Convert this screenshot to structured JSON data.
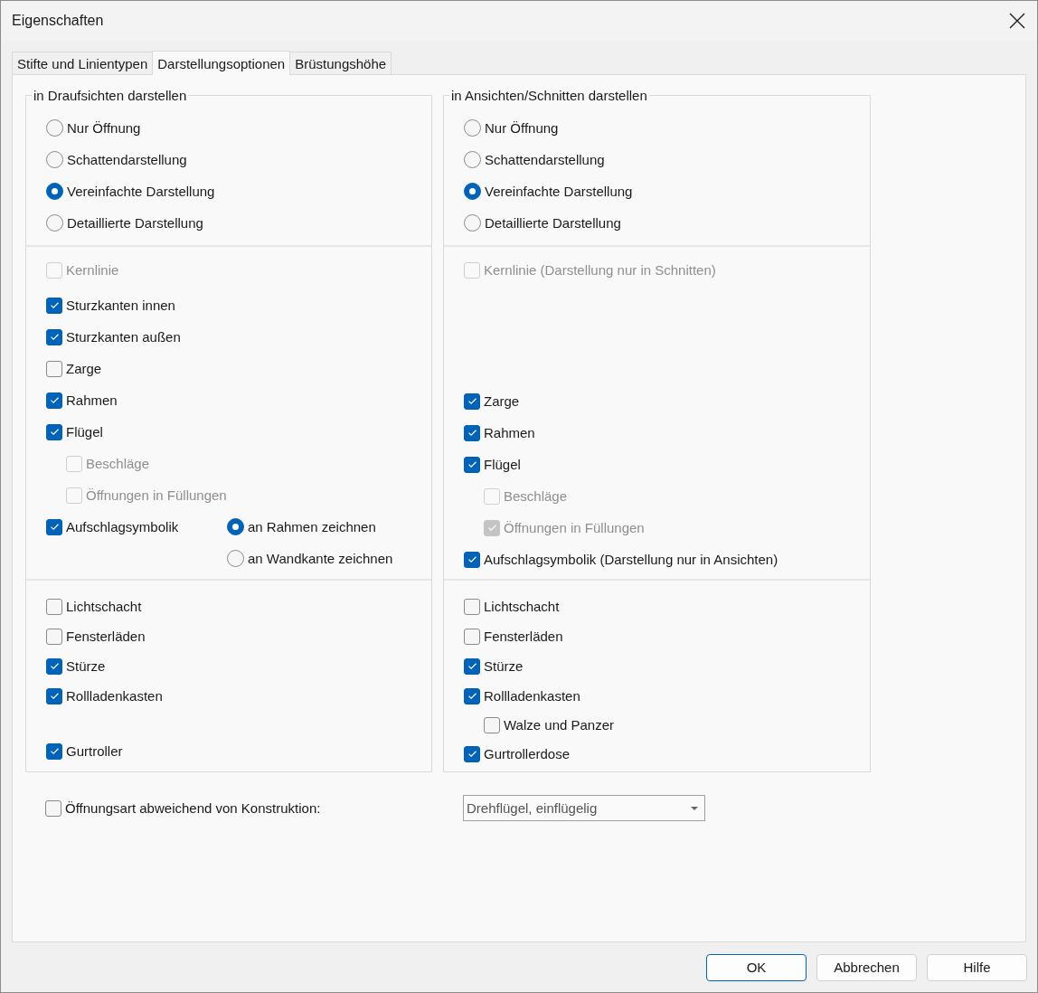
{
  "window": {
    "title": "Eigenschaften"
  },
  "tabs": [
    {
      "label": "Stifte und Linientypen",
      "selected": false
    },
    {
      "label": "Darstellungsoptionen",
      "selected": true
    },
    {
      "label": "Brüstungshöhe",
      "selected": false
    }
  ],
  "groups": [
    {
      "title": "in Draufsichten darstellen",
      "sections": [
        {
          "items": [
            {
              "kind": "radio",
              "label": "Nur Öffnung",
              "selected": false,
              "disabled": false
            },
            {
              "kind": "radio",
              "label": "Schattendarstellung",
              "selected": false,
              "disabled": false
            },
            {
              "kind": "radio",
              "label": "Vereinfachte Darstellung",
              "selected": true,
              "disabled": false
            },
            {
              "kind": "radio",
              "label": "Detaillierte Darstellung",
              "selected": false,
              "disabled": false
            }
          ]
        },
        {
          "items": [
            {
              "kind": "checkbox",
              "label": "Kernlinie",
              "checked": false,
              "disabled": true
            },
            {
              "kind": "checkbox",
              "label": "Sturzkanten innen",
              "checked": true,
              "disabled": false
            },
            {
              "kind": "checkbox",
              "label": "Sturzkanten außen",
              "checked": true,
              "disabled": false
            },
            {
              "kind": "checkbox",
              "label": "Zarge",
              "checked": false,
              "disabled": false
            },
            {
              "kind": "checkbox",
              "label": "Rahmen",
              "checked": true,
              "disabled": false
            },
            {
              "kind": "checkbox",
              "label": "Flügel",
              "checked": true,
              "disabled": false,
              "children": [
                {
                  "kind": "checkbox",
                  "label": "Beschläge",
                  "checked": false,
                  "disabled": true
                },
                {
                  "kind": "checkbox",
                  "label": "Öffnungen in Füllungen",
                  "checked": false,
                  "disabled": true
                }
              ]
            },
            {
              "kind": "checkbox",
              "label": "Aufschlagsymbolik",
              "checked": true,
              "disabled": false,
              "options": [
                {
                  "label": "an Rahmen zeichnen",
                  "selected": true
                },
                {
                  "label": "an Wandkante zeichnen",
                  "selected": false
                }
              ]
            }
          ]
        },
        {
          "items": [
            {
              "kind": "checkbox",
              "label": "Lichtschacht",
              "checked": false,
              "disabled": false
            },
            {
              "kind": "checkbox",
              "label": "Fensterläden",
              "checked": false,
              "disabled": false
            },
            {
              "kind": "checkbox",
              "label": "Stürze",
              "checked": true,
              "disabled": false
            },
            {
              "kind": "checkbox",
              "label": "Rollladenkasten",
              "checked": true,
              "disabled": false
            },
            {
              "kind": "checkbox",
              "label": "Gurtroller",
              "checked": true,
              "disabled": false
            }
          ]
        }
      ]
    },
    {
      "title": "in Ansichten/Schnitten darstellen",
      "sections": [
        {
          "items": [
            {
              "kind": "radio",
              "label": "Nur Öffnung",
              "selected": false,
              "disabled": false
            },
            {
              "kind": "radio",
              "label": "Schattendarstellung",
              "selected": false,
              "disabled": false
            },
            {
              "kind": "radio",
              "label": "Vereinfachte Darstellung",
              "selected": true,
              "disabled": false
            },
            {
              "kind": "radio",
              "label": "Detaillierte Darstellung",
              "selected": false,
              "disabled": false
            }
          ]
        },
        {
          "items": [
            {
              "kind": "checkbox",
              "label": "Kernlinie (Darstellung nur in Schnitten)",
              "checked": false,
              "disabled": true
            },
            {
              "kind": "checkbox",
              "label": "Zarge",
              "checked": true,
              "disabled": false
            },
            {
              "kind": "checkbox",
              "label": "Rahmen",
              "checked": true,
              "disabled": false
            },
            {
              "kind": "checkbox",
              "label": "Flügel",
              "checked": true,
              "disabled": false,
              "children": [
                {
                  "kind": "checkbox",
                  "label": "Beschläge",
                  "checked": false,
                  "disabled": true
                },
                {
                  "kind": "checkbox",
                  "label": "Öffnungen in Füllungen",
                  "checked": true,
                  "disabled": true
                }
              ]
            },
            {
              "kind": "checkbox",
              "label": "Aufschlagsymbolik (Darstellung nur in Ansichten)",
              "checked": true,
              "disabled": false
            }
          ]
        },
        {
          "items": [
            {
              "kind": "checkbox",
              "label": "Lichtschacht",
              "checked": false,
              "disabled": false
            },
            {
              "kind": "checkbox",
              "label": "Fensterläden",
              "checked": false,
              "disabled": false
            },
            {
              "kind": "checkbox",
              "label": "Stürze",
              "checked": true,
              "disabled": false
            },
            {
              "kind": "checkbox",
              "label": "Rollladenkasten",
              "checked": true,
              "disabled": false,
              "children": [
                {
                  "kind": "checkbox",
                  "label": "Walze und Panzer",
                  "checked": false,
                  "disabled": false
                }
              ]
            },
            {
              "kind": "checkbox",
              "label": "Gurtrollerdose",
              "checked": true,
              "disabled": false
            }
          ]
        }
      ]
    }
  ],
  "override": {
    "label": "Öffnungsart abweichend von Konstruktion:",
    "checked": false
  },
  "dropdown": {
    "value": "Drehflügel, einflügelig",
    "disabled": true
  },
  "buttons": [
    {
      "label": "OK",
      "default": true
    },
    {
      "label": "Abbrechen",
      "default": false
    },
    {
      "label": "Hilfe",
      "default": false
    }
  ]
}
